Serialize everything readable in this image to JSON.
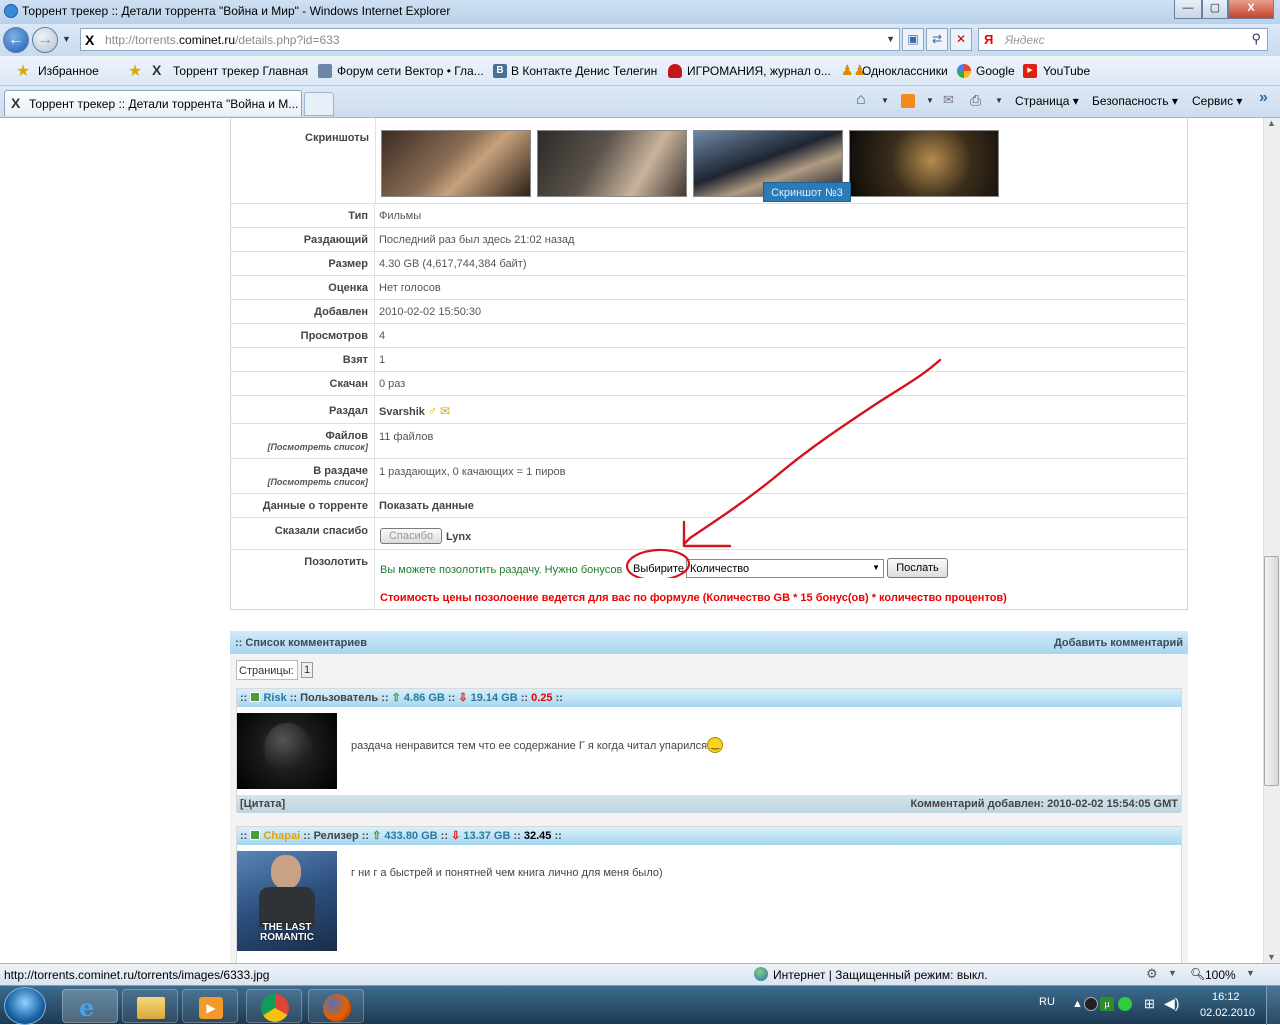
{
  "window": {
    "title": "Торрент трекер :: Детали торрента \"Война и Мир\" - Windows Internet Explorer",
    "min": "—",
    "max": "▢",
    "close": "X"
  },
  "address": {
    "prefix": "http://torrents.",
    "domain": "cominet.ru",
    "path": "/details.php?id=633"
  },
  "search": {
    "logo": "Я",
    "placeholder": "Яндекс"
  },
  "favorites": {
    "label": "Избранное",
    "items": [
      "Торрент трекер  Главная",
      "Форум сети Вектор • Гла...",
      "В Контакте  Денис Телегин",
      "ИГРОМАНИЯ, журнал о...",
      "Одноклассники",
      "Google",
      "YouTube"
    ]
  },
  "tab": {
    "title": "Торрент трекер :: Детали торрента \"Война и М..."
  },
  "commands": [
    "Страница",
    "Безопасность",
    "Сервис"
  ],
  "details": {
    "screenshots_label": "Скриншоты",
    "tooltip": "Скриншот №3",
    "rows": [
      {
        "label": "Тип",
        "value": "Фильмы"
      },
      {
        "label": "Раздающий",
        "value": "Последний раз был здесь 21:02 назад"
      },
      {
        "label": "Размер",
        "value": "4.30 GB (4,617,744,384 байт)"
      },
      {
        "label": "Оценка",
        "value": "Нет голосов"
      },
      {
        "label": "Добавлен",
        "value": "2010-02-02 15:50:30"
      },
      {
        "label": "Просмотров",
        "value": "4"
      },
      {
        "label": "Взят",
        "value": "1"
      },
      {
        "label": "Скачан",
        "value": "0 раз"
      }
    ],
    "uploader_label": "Раздал",
    "uploader": "Svarshik",
    "files_label": "Файлов",
    "files_sub": "[Посмотреть список]",
    "files_value": "11 файлов",
    "peers_label": "В раздаче",
    "peers_sub": "[Посмотреть список]",
    "peers_value": "1 раздающих, 0 качающих = 1 пиров",
    "torrent_data_label": "Данные о торренте",
    "torrent_data_value": "Показать данные",
    "thanks_label": "Сказали спасибо",
    "thanks_button": "Спасибо",
    "thanks_user": "Lynx",
    "gild_label": "Позолотить",
    "gild_text": "Вы можете позолотить раздачу. Нужно бонусов",
    "gild_choose": "Выбирите",
    "gild_select": "Количество",
    "gild_send": "Послать",
    "gild_formula": "Стоимость цены позолоение ведется для вас по формуле (Количество GB * 15 бонус(ов) * количество процентов)"
  },
  "comments": {
    "header": ":: Список комментариев",
    "add": "Добавить комментарий",
    "pages_label": "Страницы:",
    "page": "1",
    "posts": [
      {
        "user": "Risk",
        "role": ":: Пользователь ::",
        "up": "4.86 GB",
        "down": "19.14 GB",
        "ratio": "0.25",
        "text": "раздача ненравится тем что  ее содержание Г я когда читал упарился",
        "quote": "[Цитата]",
        "added": "Комментарий добавлен: 2010-02-02 15:54:05 GMT"
      },
      {
        "user": "Chapai",
        "role": ":: Релизер ::",
        "up": "433.80 GB",
        "down": "13.37 GB",
        "ratio": "32.45",
        "text": "г ни г а быстрей и понятней чем книга лично для меня было)",
        "avatar_text": "THE LAST ROMANTIC"
      }
    ]
  },
  "status": {
    "url": "http://torrents.cominet.ru/torrents/images/6333.jpg",
    "zone": "Интернет | Защищенный режим: выкл.",
    "zoom": "100%"
  },
  "taskbar": {
    "lang": "RU",
    "time": "16:12",
    "date": "02.02.2010"
  },
  "colors": {
    "annotation": "#d4141c",
    "link_blue": "#2d7bb6",
    "header_blue": "#a9d6ef"
  }
}
